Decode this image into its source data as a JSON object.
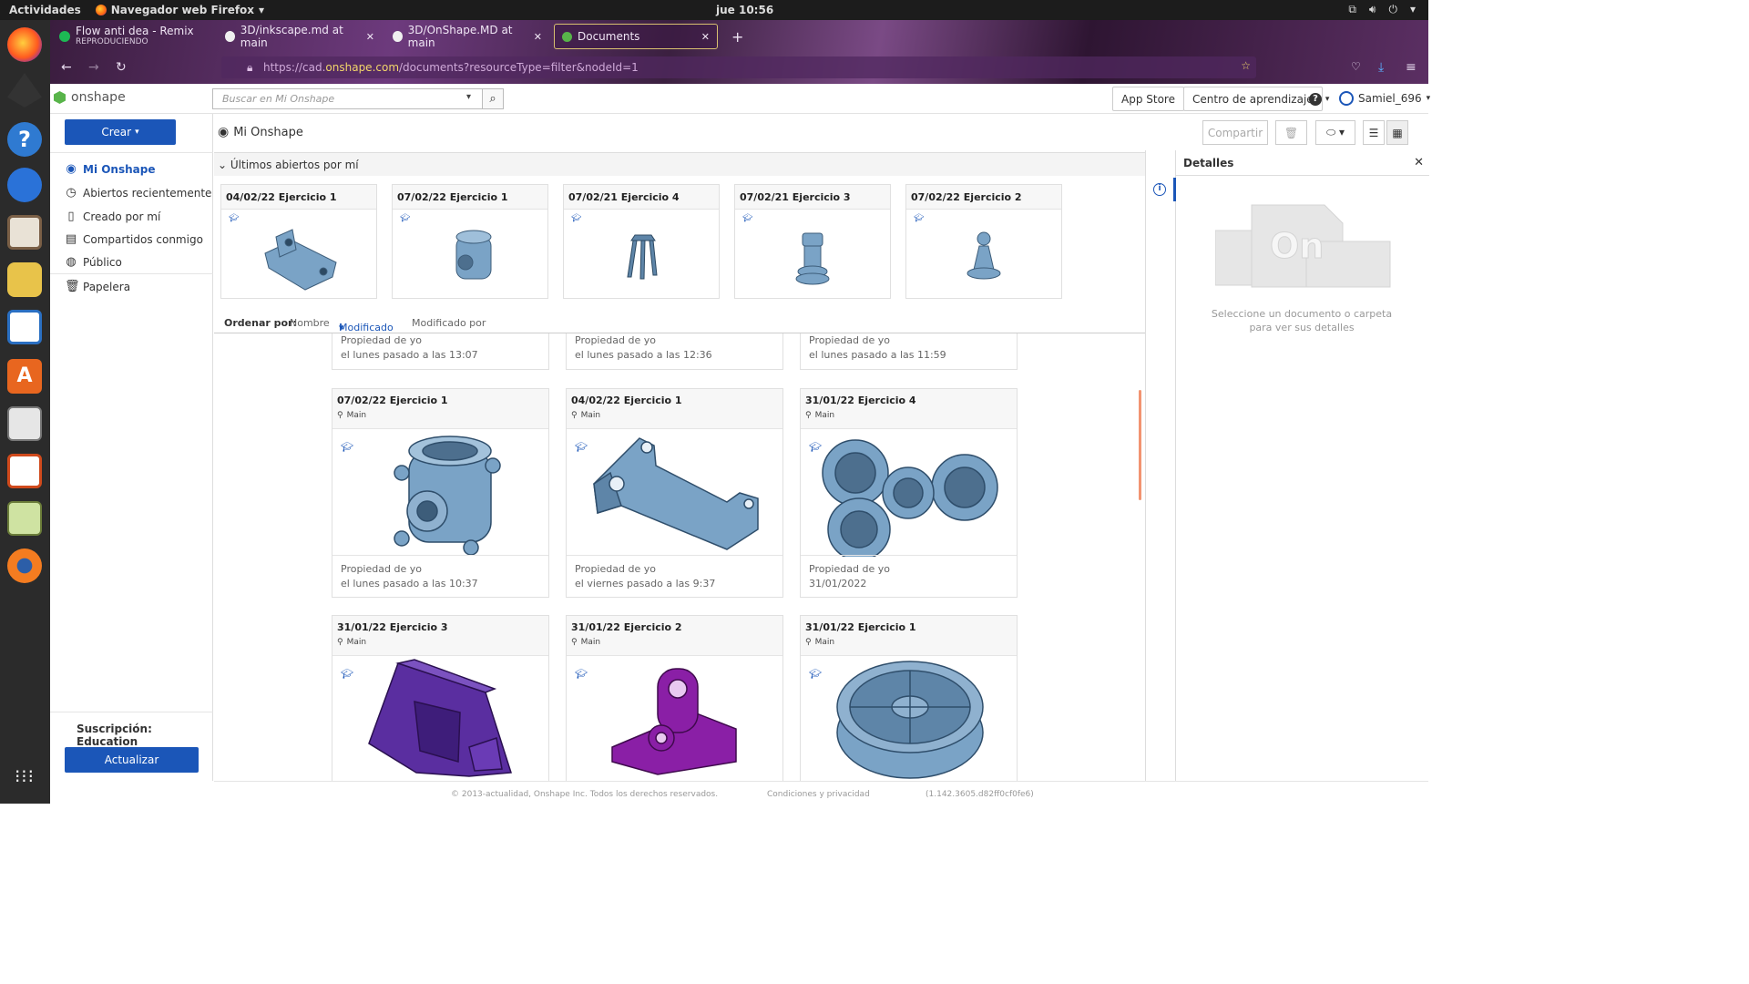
{
  "os": {
    "activities": "Actividades",
    "app_name": "Navegador web Firefox",
    "clock": "jue 10:56"
  },
  "browser": {
    "tabs": [
      {
        "title": "Flow anti dea - Remix",
        "subtitle": "REPRODUCIENDO"
      },
      {
        "title": "3D/inkscape.md at main"
      },
      {
        "title": "3D/OnShape.MD at main"
      },
      {
        "title": "Documents"
      }
    ],
    "url_prefix": "https://cad.",
    "url_domain": "onshape.com",
    "url_path": "/documents?resourceType=filter&nodeId=1"
  },
  "app": {
    "logo": "onshape",
    "search_placeholder": "Buscar en Mi Onshape",
    "app_store": "App Store",
    "learning_center": "Centro de aprendizaje",
    "user": "Samiel_696"
  },
  "sidebar": {
    "create": "Crear",
    "items": [
      {
        "label": "Mi Onshape"
      },
      {
        "label": "Abiertos recientemente"
      },
      {
        "label": "Creado por mí"
      },
      {
        "label": "Compartidos conmigo"
      },
      {
        "label": "Público"
      },
      {
        "label": "Papelera"
      }
    ],
    "subscription_label": "Suscripción:",
    "subscription_value": "Education",
    "update": "Actualizar"
  },
  "main": {
    "title": "Mi Onshape",
    "share": "Compartir",
    "recent_header": "Últimos abiertos por mí",
    "recent": [
      {
        "name": "04/02/22 Ejercicio 1"
      },
      {
        "name": "07/02/22 Ejercicio 1"
      },
      {
        "name": "07/02/21 Ejercicio 4"
      },
      {
        "name": "07/02/21 Ejercicio 3"
      },
      {
        "name": "07/02/22 Ejercicio 2"
      }
    ],
    "sort_label": "Ordenar por:",
    "sort_options": [
      "Nombre",
      "Modificado",
      "Modificado por"
    ],
    "partial_row": [
      {
        "owner": "Propiedad de yo",
        "modified": "el lunes pasado a las 13:07"
      },
      {
        "owner": "Propiedad de yo",
        "modified": "el lunes pasado a las 12:36"
      },
      {
        "owner": "Propiedad de yo",
        "modified": "el lunes pasado a las 11:59"
      }
    ],
    "docs": [
      {
        "name": "07/02/22 Ejercicio 1",
        "branch": "Main",
        "owner": "Propiedad de yo",
        "modified": "el lunes pasado a las 10:37"
      },
      {
        "name": "04/02/22 Ejercicio 1",
        "branch": "Main",
        "owner": "Propiedad de yo",
        "modified": "el viernes pasado a las 9:37"
      },
      {
        "name": "31/01/22 Ejercicio 4",
        "branch": "Main",
        "owner": "Propiedad de yo",
        "modified": "31/01/2022"
      },
      {
        "name": "31/01/22 Ejercicio 3",
        "branch": "Main"
      },
      {
        "name": "31/01/22 Ejercicio 2",
        "branch": "Main"
      },
      {
        "name": "31/01/22 Ejercicio 1",
        "branch": "Main"
      }
    ]
  },
  "details": {
    "title": "Detalles",
    "empty": "Seleccione un documento o carpeta para ver sus detalles"
  },
  "footer": {
    "copyright": "© 2013-actualidad, Onshape Inc. Todos los derechos reservados.",
    "terms": "Condiciones y privacidad",
    "version": "(1.142.3605.d82ff0cf0fe6)"
  },
  "colors": {
    "accent": "#1b56b8",
    "part_blue": "#6f9ac0",
    "part_purple": "#5a2ea0",
    "part_magenta": "#8a1fa6"
  }
}
